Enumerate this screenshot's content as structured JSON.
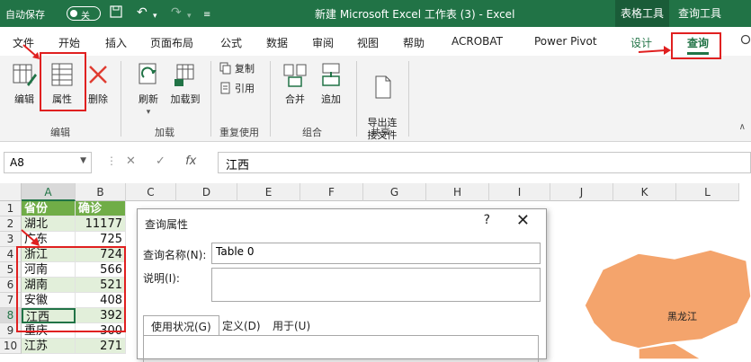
{
  "titlebar": {
    "autosave_label": "自动保存",
    "autosave_state": "关",
    "title": "新建 Microsoft Excel 工作表 (3)  -  Excel",
    "context_tabs": [
      "表格工具",
      "查询工具"
    ]
  },
  "ribbon_tabs": [
    "文件",
    "开始",
    "插入",
    "页面布局",
    "公式",
    "数据",
    "审阅",
    "视图",
    "帮助",
    "ACROBAT",
    "Power Pivot",
    "设计",
    "查询"
  ],
  "ribbon": {
    "edit_group": {
      "label": "编辑",
      "buttons": [
        "编辑",
        "属性",
        "删除"
      ]
    },
    "load_group": {
      "label": "加载",
      "buttons": [
        "刷新",
        "加载到"
      ]
    },
    "reuse_group": {
      "label": "重复使用",
      "buttons": [
        "复制",
        "引用"
      ]
    },
    "combine_group": {
      "label": "组合",
      "buttons": [
        "合并",
        "追加"
      ]
    },
    "share_group": {
      "label": "共享",
      "buttons": [
        "导出连\n接文件"
      ]
    }
  },
  "formula_bar": {
    "name_box": "A8",
    "fx": "fx",
    "value": "江西"
  },
  "grid": {
    "columns": [
      "A",
      "B",
      "C",
      "D",
      "E",
      "F",
      "G",
      "H",
      "I",
      "J",
      "K",
      "L"
    ],
    "rows": [
      "1",
      "2",
      "3",
      "4",
      "5",
      "6",
      "7",
      "8",
      "9",
      "10"
    ],
    "header": [
      "省份",
      "确诊"
    ],
    "data": [
      [
        "湖北",
        "11177"
      ],
      [
        "广东",
        "725"
      ],
      [
        "浙江",
        "724"
      ],
      [
        "河南",
        "566"
      ],
      [
        "湖南",
        "521"
      ],
      [
        "安徽",
        "408"
      ],
      [
        "江西",
        "392"
      ],
      [
        "重庆",
        "300"
      ],
      [
        "江苏",
        "271"
      ]
    ]
  },
  "map": {
    "label": "黑龙江",
    "color": "#f4a46c"
  },
  "dialog": {
    "title": "查询属性",
    "help": "?",
    "close": "✕",
    "name_label": "查询名称(N):",
    "name_value": "Table 0",
    "desc_label": "说明(I):",
    "tabs": [
      "使用状况(G)",
      "定义(D)",
      "用于(U)"
    ]
  },
  "colors": {
    "excel_green": "#217346",
    "table_header": "#70ad47",
    "table_band": "#e2efda",
    "annotation_red": "#e02020"
  }
}
